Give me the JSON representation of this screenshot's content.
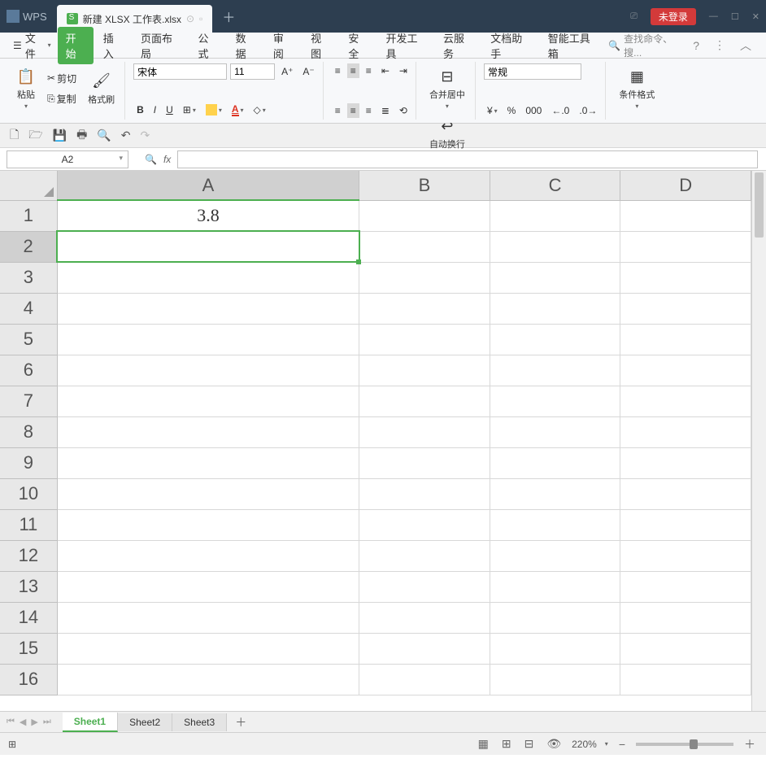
{
  "title_bar": {
    "app_name": "WPS",
    "doc_title": "新建 XLSX 工作表.xlsx",
    "login_text": "未登录"
  },
  "menu": {
    "file": "文件",
    "items": [
      "开始",
      "插入",
      "页面布局",
      "公式",
      "数据",
      "审阅",
      "视图",
      "安全",
      "开发工具",
      "云服务",
      "文档助手",
      "智能工具箱"
    ],
    "active_index": 0,
    "search_placeholder": "查找命令、搜..."
  },
  "ribbon": {
    "paste": "粘贴",
    "cut": "剪切",
    "copy": "复制",
    "format_painter": "格式刷",
    "font_name": "宋体",
    "font_size": "11",
    "bold": "B",
    "italic": "I",
    "underline": "U",
    "merge_center": "合并居中",
    "wrap_text": "自动换行",
    "number_format": "常规",
    "cond_format": "条件格式"
  },
  "name_box": "A2",
  "formula_bar": "",
  "sheet": {
    "columns": [
      "A",
      "B",
      "C",
      "D"
    ],
    "rows": [
      "1",
      "2",
      "3",
      "4",
      "5",
      "6",
      "7",
      "8",
      "9",
      "10",
      "11",
      "12",
      "13",
      "14",
      "15",
      "16"
    ],
    "selected_col": "A",
    "selected_row": "2",
    "active_cell": "A2",
    "cells": {
      "A1": "3.8"
    }
  },
  "sheet_tabs": {
    "tabs": [
      "Sheet1",
      "Sheet2",
      "Sheet3"
    ],
    "active_index": 0
  },
  "status": {
    "zoom": "220%"
  }
}
